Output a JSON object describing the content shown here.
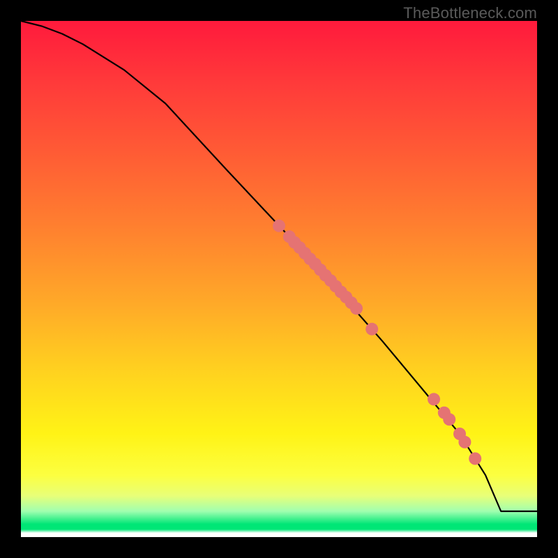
{
  "watermark": "TheBottleneck.com",
  "chart_data": {
    "type": "line",
    "title": "",
    "xlabel": "",
    "ylabel": "",
    "xlim": [
      0,
      100
    ],
    "ylim": [
      0,
      100
    ],
    "grid": false,
    "series": [
      {
        "name": "curve",
        "x": [
          0,
          4,
          8,
          12,
          16,
          20,
          28,
          40,
          55,
          70,
          85,
          90,
          93,
          100
        ],
        "y": [
          100,
          99,
          97.5,
          95.5,
          93,
          90.5,
          84,
          71,
          55,
          38,
          20,
          12,
          5,
          5
        ]
      }
    ],
    "points": {
      "name": "markers",
      "x": [
        50,
        52,
        53,
        54,
        55,
        56,
        57,
        58,
        59,
        60,
        61,
        62,
        63,
        64,
        65,
        68,
        80,
        82,
        83,
        85,
        86,
        88
      ],
      "y": [
        60.3,
        58.2,
        57.1,
        56.1,
        55.0,
        53.9,
        52.9,
        51.8,
        50.7,
        49.7,
        48.6,
        47.5,
        46.5,
        45.4,
        44.3,
        40.3,
        26.7,
        24.1,
        22.8,
        20.0,
        18.4,
        15.2
      ]
    },
    "gradient_stops": [
      {
        "pos": 0.0,
        "color": "#ff1a3c"
      },
      {
        "pos": 0.25,
        "color": "#ff5a35"
      },
      {
        "pos": 0.55,
        "color": "#ffaa28"
      },
      {
        "pos": 0.8,
        "color": "#fff316"
      },
      {
        "pos": 0.95,
        "color": "#a0ffb0"
      },
      {
        "pos": 0.98,
        "color": "#00e676"
      },
      {
        "pos": 1.0,
        "color": "#ffffff"
      }
    ]
  }
}
